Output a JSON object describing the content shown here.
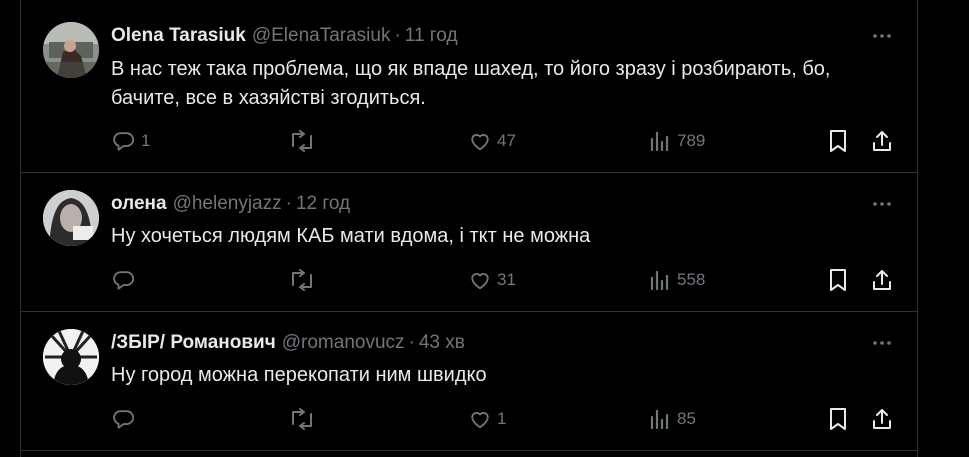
{
  "posts": [
    {
      "name": "Olena Tarasiuk",
      "handle": "@ElenaTarasiuk",
      "dot": "·",
      "time": "11 год",
      "text_lines": [
        "В нас теж така проблема, що як впаде шахед, то його зразу і розбирають, бо,",
        "бачите, все в хазяйстві згодиться."
      ],
      "replies": "1",
      "reposts": "",
      "likes": "47",
      "views": "789"
    },
    {
      "name": "олена",
      "handle": "@helenyjazz",
      "dot": "·",
      "time": "12 год",
      "text_lines": [
        "Ну хочеться людям КАБ мати вдома, і ткт не можна"
      ],
      "replies": "",
      "reposts": "",
      "likes": "31",
      "views": "558"
    },
    {
      "name": "/ЗБІР/ Романович",
      "handle": "@romanovucz",
      "dot": "·",
      "time": "43 хв",
      "text_lines": [
        "Ну город можна перекопати ним швидко"
      ],
      "replies": "",
      "reposts": "",
      "likes": "1",
      "views": "85"
    }
  ],
  "icons": {
    "reply": "reply-icon",
    "repost": "repost-icon",
    "like": "heart-icon",
    "views": "views-icon",
    "bookmark": "bookmark-icon",
    "share": "share-icon",
    "more": "more-icon"
  },
  "colors": {
    "background": "#000000",
    "text": "#e7e9ea",
    "muted": "#71767b",
    "border": "#2f3336"
  }
}
